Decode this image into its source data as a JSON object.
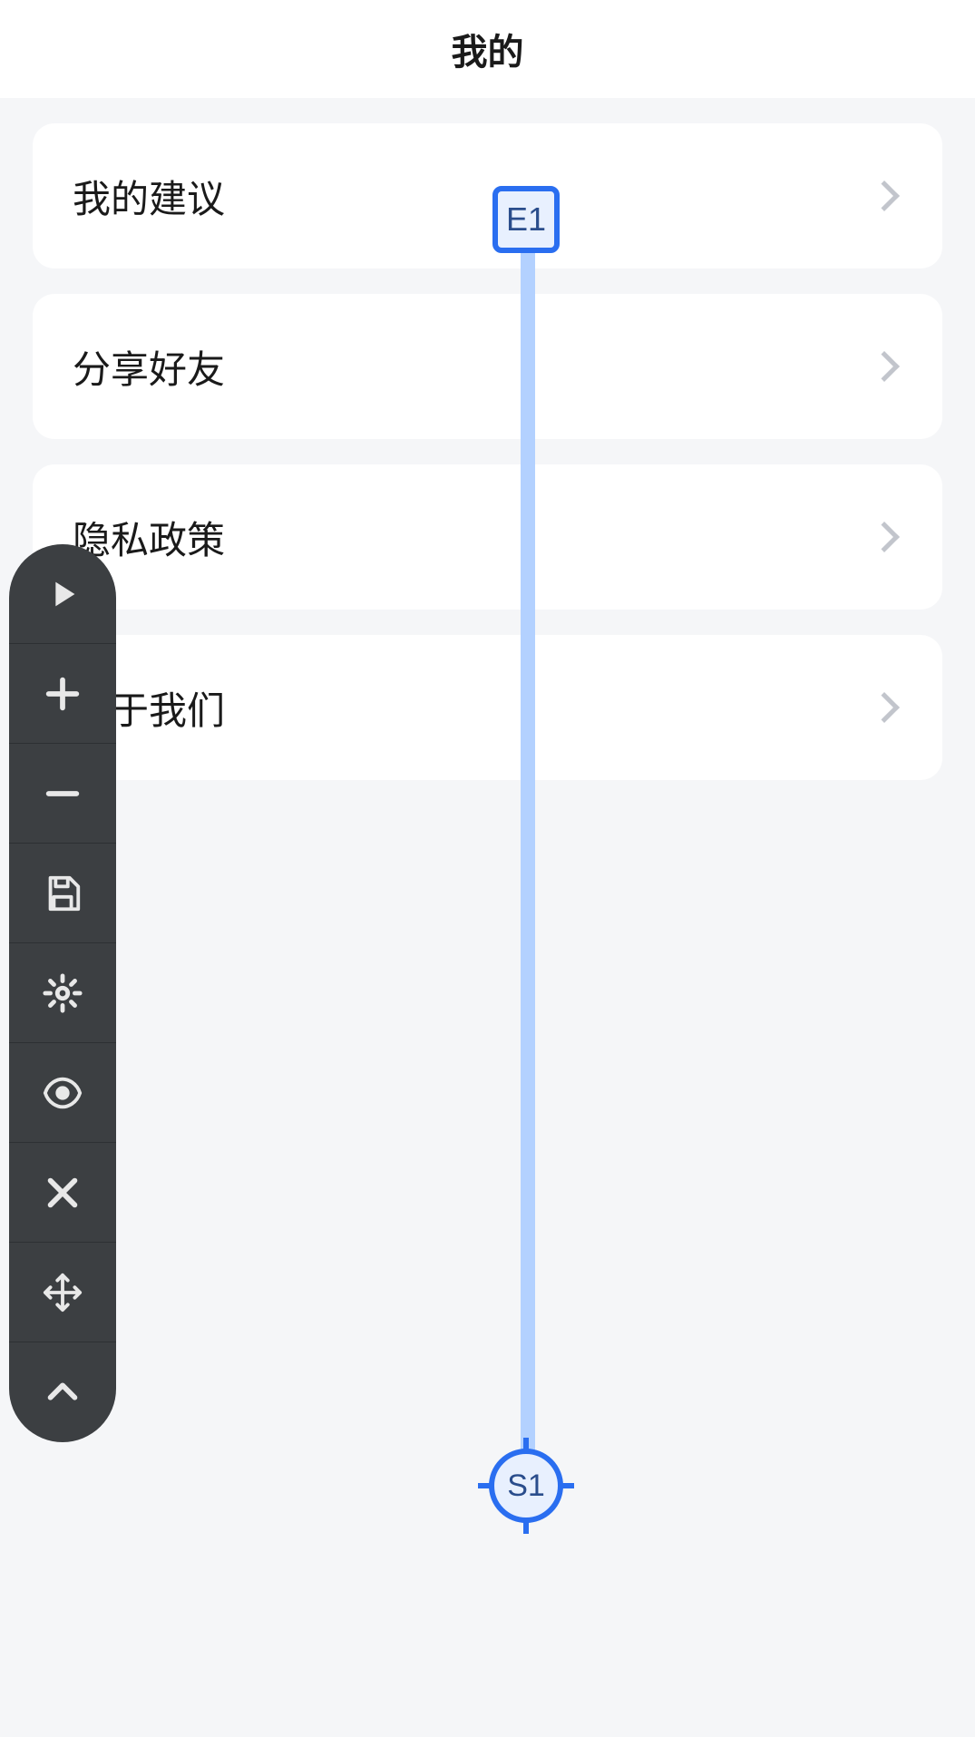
{
  "header": {
    "title": "我的"
  },
  "menu": {
    "items": [
      {
        "label": "我的建议"
      },
      {
        "label": "分享好友"
      },
      {
        "label": "隐私政策"
      },
      {
        "label": "关于我们"
      }
    ]
  },
  "toolbar": {
    "icons": [
      "play-icon",
      "plus-icon",
      "minus-icon",
      "save-icon",
      "gear-icon",
      "eye-icon",
      "close-icon",
      "move-icon",
      "chevron-up-icon"
    ]
  },
  "annotation": {
    "end_label": "E1",
    "start_label": "S1",
    "colors": {
      "marker_border": "#2a6ef0",
      "line": "#b3d1ff"
    }
  }
}
